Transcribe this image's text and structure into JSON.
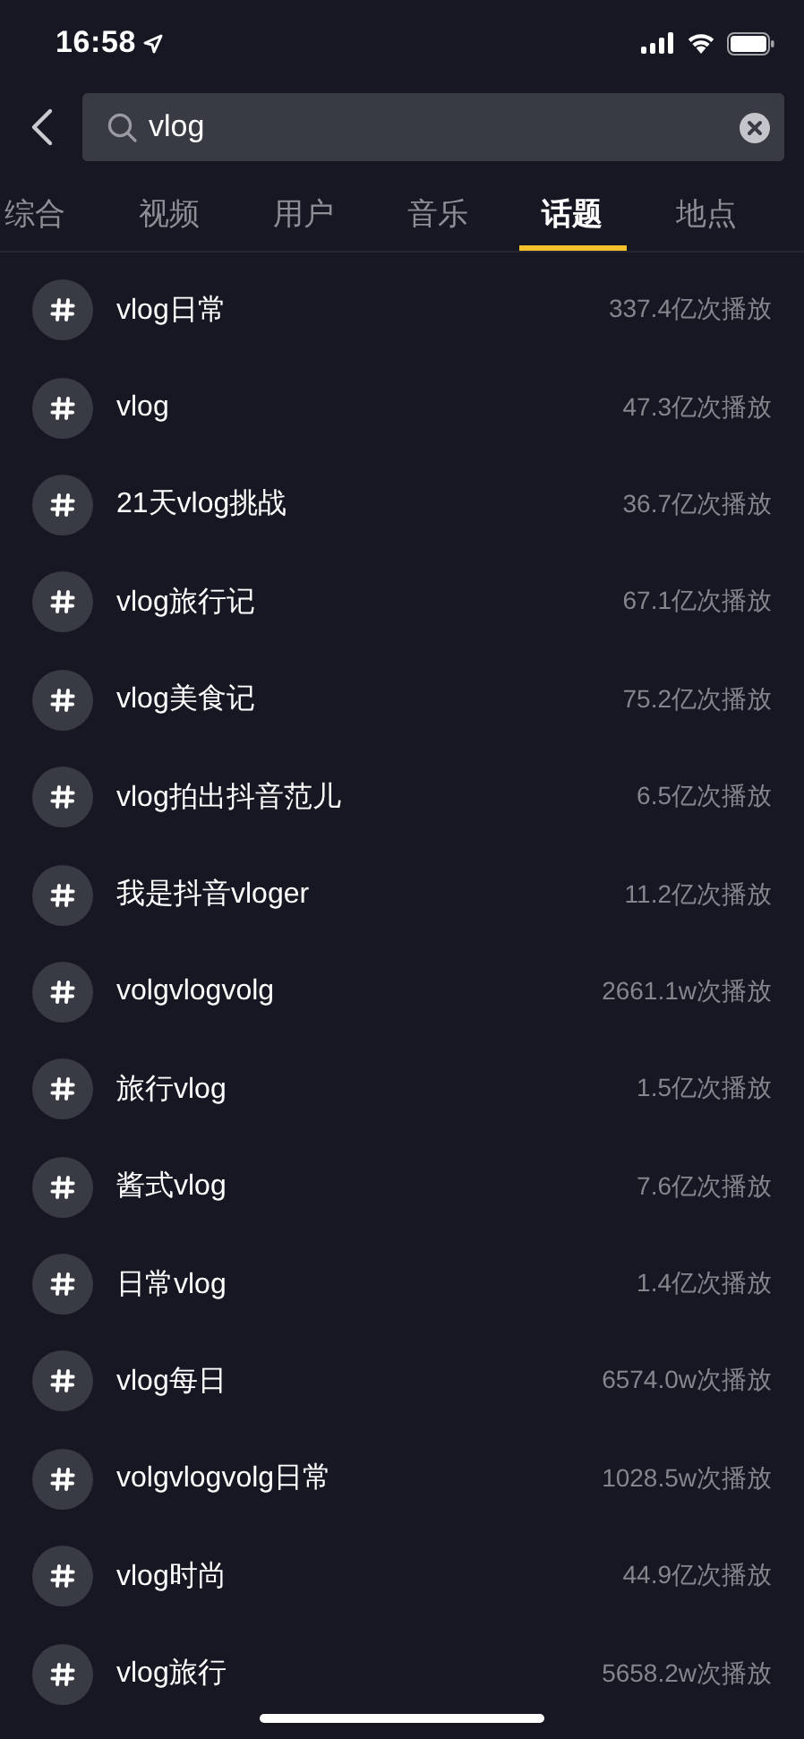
{
  "status_bar": {
    "time": "16:58"
  },
  "search": {
    "value": "vlog"
  },
  "tabs": [
    {
      "label": "综合",
      "selected": false
    },
    {
      "label": "视频",
      "selected": false
    },
    {
      "label": "用户",
      "selected": false
    },
    {
      "label": "音乐",
      "selected": false
    },
    {
      "label": "话题",
      "selected": true
    },
    {
      "label": "地点",
      "selected": false
    }
  ],
  "topics": [
    {
      "name": "vlog日常",
      "plays": "337.4亿次播放"
    },
    {
      "name": "vlog",
      "plays": "47.3亿次播放"
    },
    {
      "name": "21天vlog挑战",
      "plays": "36.7亿次播放"
    },
    {
      "name": "vlog旅行记",
      "plays": "67.1亿次播放"
    },
    {
      "name": "vlog美食记",
      "plays": "75.2亿次播放"
    },
    {
      "name": "vlog拍出抖音范儿",
      "plays": "6.5亿次播放"
    },
    {
      "name": "我是抖音vloger",
      "plays": "11.2亿次播放"
    },
    {
      "name": "volgvlogvolg",
      "plays": "2661.1w次播放"
    },
    {
      "name": "旅行vlog",
      "plays": "1.5亿次播放"
    },
    {
      "name": "酱式vlog",
      "plays": "7.6亿次播放"
    },
    {
      "name": "日常vlog",
      "plays": "1.4亿次播放"
    },
    {
      "name": "vlog每日",
      "plays": "6574.0w次播放"
    },
    {
      "name": "volgvlogvolg日常",
      "plays": "1028.5w次播放"
    },
    {
      "name": "vlog时尚",
      "plays": "44.9亿次播放"
    },
    {
      "name": "vlog旅行",
      "plays": "5658.2w次播放"
    }
  ]
}
